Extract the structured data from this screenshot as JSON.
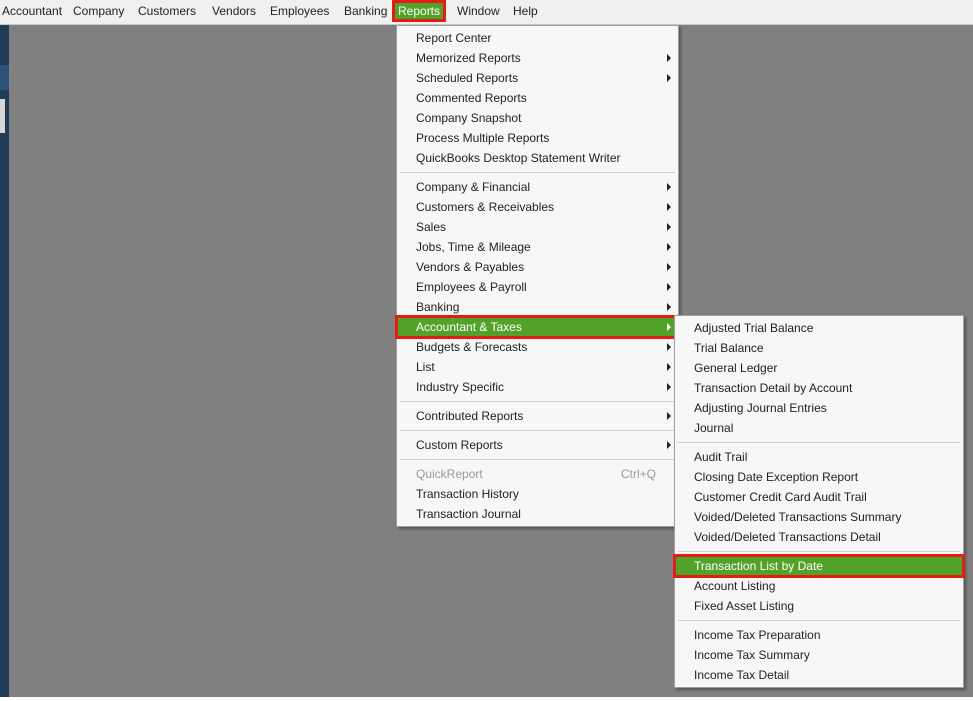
{
  "menubar": [
    {
      "label": "Accountant"
    },
    {
      "label": "Company"
    },
    {
      "label": "Customers"
    },
    {
      "label": "Vendors"
    },
    {
      "label": "Employees"
    },
    {
      "label": "Banking"
    },
    {
      "label": "Reports"
    },
    {
      "label": "Window"
    },
    {
      "label": "Help"
    }
  ],
  "reports_menu": {
    "items": [
      {
        "label": "Report Center"
      },
      {
        "label": "Memorized Reports"
      },
      {
        "label": "Scheduled Reports"
      },
      {
        "label": "Commented Reports"
      },
      {
        "label": "Company Snapshot"
      },
      {
        "label": "Process Multiple Reports"
      },
      {
        "label": "QuickBooks Desktop Statement Writer"
      },
      {
        "label": "Company & Financial"
      },
      {
        "label": "Customers & Receivables"
      },
      {
        "label": "Sales"
      },
      {
        "label": "Jobs, Time & Mileage"
      },
      {
        "label": "Vendors & Payables"
      },
      {
        "label": "Employees & Payroll"
      },
      {
        "label": "Banking"
      },
      {
        "label": "Accountant & Taxes"
      },
      {
        "label": "Budgets & Forecasts"
      },
      {
        "label": "List"
      },
      {
        "label": "Industry Specific"
      },
      {
        "label": "Contributed Reports"
      },
      {
        "label": "Custom Reports"
      },
      {
        "label": "QuickReport",
        "shortcut": "Ctrl+Q"
      },
      {
        "label": "Transaction History"
      },
      {
        "label": "Transaction Journal"
      }
    ]
  },
  "accountant_submenu": {
    "items": [
      {
        "label": "Adjusted Trial Balance"
      },
      {
        "label": "Trial Balance"
      },
      {
        "label": "General Ledger"
      },
      {
        "label": "Transaction Detail by Account"
      },
      {
        "label": "Adjusting Journal Entries"
      },
      {
        "label": "Journal"
      },
      {
        "label": "Audit Trail"
      },
      {
        "label": "Closing Date Exception Report"
      },
      {
        "label": "Customer Credit Card Audit Trail"
      },
      {
        "label": "Voided/Deleted Transactions Summary"
      },
      {
        "label": "Voided/Deleted Transactions Detail"
      },
      {
        "label": "Transaction List by Date"
      },
      {
        "label": "Account Listing"
      },
      {
        "label": "Fixed Asset Listing"
      },
      {
        "label": "Income Tax Preparation"
      },
      {
        "label": "Income Tax Summary"
      },
      {
        "label": "Income Tax Detail"
      }
    ]
  },
  "colors": {
    "highlight": "#52a22a",
    "highlight_border": "#e41b17",
    "workspace": "#808080"
  }
}
